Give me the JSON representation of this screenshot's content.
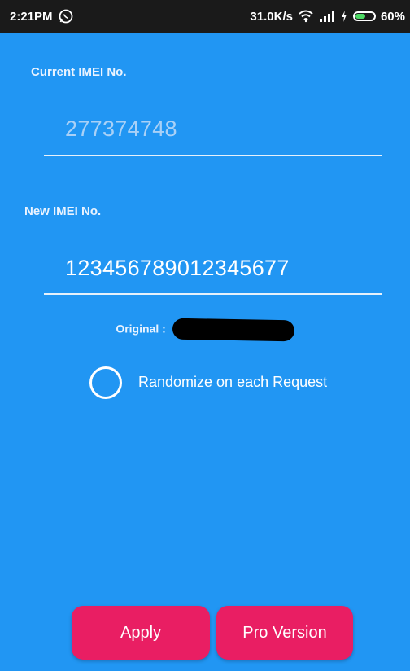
{
  "status_bar": {
    "time": "2:21PM",
    "speed": "31.0K/s",
    "battery": "60%",
    "battery_level": 0.6,
    "icons": [
      "whatsapp-icon",
      "wifi-icon",
      "signal-icon",
      "charging-icon",
      "battery-icon"
    ]
  },
  "current_imei": {
    "label": "Current IMEI No.",
    "value": "277374748"
  },
  "new_imei": {
    "label": "New IMEI No.",
    "value": "12345678901234567​7"
  },
  "original": {
    "label": "Original :"
  },
  "randomize": {
    "label": "Randomize on each Request",
    "checked": false
  },
  "buttons": {
    "apply": "Apply",
    "pro": "Pro Version"
  },
  "colors": {
    "background": "#2196F3",
    "button": "#E91E63",
    "status_bar": "#1a1a1a"
  }
}
